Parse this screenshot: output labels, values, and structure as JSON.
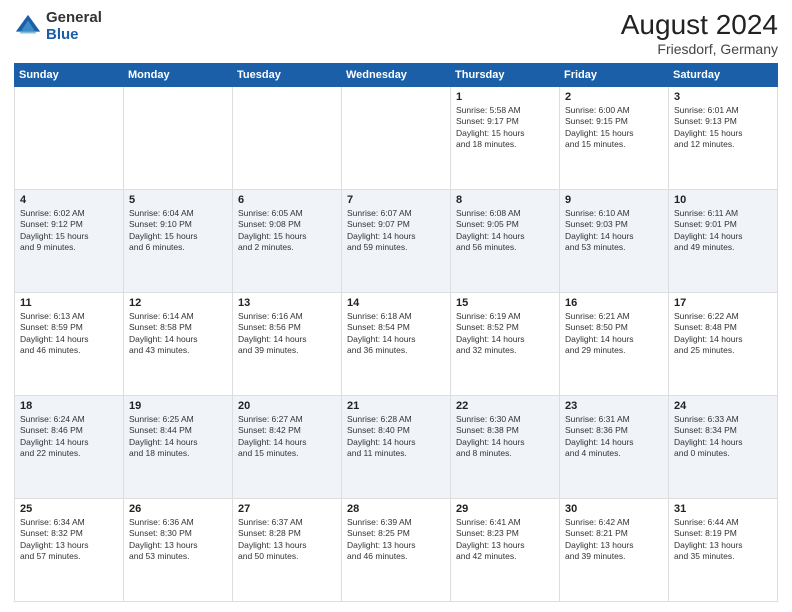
{
  "header": {
    "logo_general": "General",
    "logo_blue": "Blue",
    "title": "August 2024",
    "subtitle": "Friesdorf, Germany"
  },
  "days_of_week": [
    "Sunday",
    "Monday",
    "Tuesday",
    "Wednesday",
    "Thursday",
    "Friday",
    "Saturday"
  ],
  "weeks": [
    [
      {
        "day": "",
        "info": ""
      },
      {
        "day": "",
        "info": ""
      },
      {
        "day": "",
        "info": ""
      },
      {
        "day": "",
        "info": ""
      },
      {
        "day": "1",
        "info": "Sunrise: 5:58 AM\nSunset: 9:17 PM\nDaylight: 15 hours\nand 18 minutes."
      },
      {
        "day": "2",
        "info": "Sunrise: 6:00 AM\nSunset: 9:15 PM\nDaylight: 15 hours\nand 15 minutes."
      },
      {
        "day": "3",
        "info": "Sunrise: 6:01 AM\nSunset: 9:13 PM\nDaylight: 15 hours\nand 12 minutes."
      }
    ],
    [
      {
        "day": "4",
        "info": "Sunrise: 6:02 AM\nSunset: 9:12 PM\nDaylight: 15 hours\nand 9 minutes."
      },
      {
        "day": "5",
        "info": "Sunrise: 6:04 AM\nSunset: 9:10 PM\nDaylight: 15 hours\nand 6 minutes."
      },
      {
        "day": "6",
        "info": "Sunrise: 6:05 AM\nSunset: 9:08 PM\nDaylight: 15 hours\nand 2 minutes."
      },
      {
        "day": "7",
        "info": "Sunrise: 6:07 AM\nSunset: 9:07 PM\nDaylight: 14 hours\nand 59 minutes."
      },
      {
        "day": "8",
        "info": "Sunrise: 6:08 AM\nSunset: 9:05 PM\nDaylight: 14 hours\nand 56 minutes."
      },
      {
        "day": "9",
        "info": "Sunrise: 6:10 AM\nSunset: 9:03 PM\nDaylight: 14 hours\nand 53 minutes."
      },
      {
        "day": "10",
        "info": "Sunrise: 6:11 AM\nSunset: 9:01 PM\nDaylight: 14 hours\nand 49 minutes."
      }
    ],
    [
      {
        "day": "11",
        "info": "Sunrise: 6:13 AM\nSunset: 8:59 PM\nDaylight: 14 hours\nand 46 minutes."
      },
      {
        "day": "12",
        "info": "Sunrise: 6:14 AM\nSunset: 8:58 PM\nDaylight: 14 hours\nand 43 minutes."
      },
      {
        "day": "13",
        "info": "Sunrise: 6:16 AM\nSunset: 8:56 PM\nDaylight: 14 hours\nand 39 minutes."
      },
      {
        "day": "14",
        "info": "Sunrise: 6:18 AM\nSunset: 8:54 PM\nDaylight: 14 hours\nand 36 minutes."
      },
      {
        "day": "15",
        "info": "Sunrise: 6:19 AM\nSunset: 8:52 PM\nDaylight: 14 hours\nand 32 minutes."
      },
      {
        "day": "16",
        "info": "Sunrise: 6:21 AM\nSunset: 8:50 PM\nDaylight: 14 hours\nand 29 minutes."
      },
      {
        "day": "17",
        "info": "Sunrise: 6:22 AM\nSunset: 8:48 PM\nDaylight: 14 hours\nand 25 minutes."
      }
    ],
    [
      {
        "day": "18",
        "info": "Sunrise: 6:24 AM\nSunset: 8:46 PM\nDaylight: 14 hours\nand 22 minutes."
      },
      {
        "day": "19",
        "info": "Sunrise: 6:25 AM\nSunset: 8:44 PM\nDaylight: 14 hours\nand 18 minutes."
      },
      {
        "day": "20",
        "info": "Sunrise: 6:27 AM\nSunset: 8:42 PM\nDaylight: 14 hours\nand 15 minutes."
      },
      {
        "day": "21",
        "info": "Sunrise: 6:28 AM\nSunset: 8:40 PM\nDaylight: 14 hours\nand 11 minutes."
      },
      {
        "day": "22",
        "info": "Sunrise: 6:30 AM\nSunset: 8:38 PM\nDaylight: 14 hours\nand 8 minutes."
      },
      {
        "day": "23",
        "info": "Sunrise: 6:31 AM\nSunset: 8:36 PM\nDaylight: 14 hours\nand 4 minutes."
      },
      {
        "day": "24",
        "info": "Sunrise: 6:33 AM\nSunset: 8:34 PM\nDaylight: 14 hours\nand 0 minutes."
      }
    ],
    [
      {
        "day": "25",
        "info": "Sunrise: 6:34 AM\nSunset: 8:32 PM\nDaylight: 13 hours\nand 57 minutes."
      },
      {
        "day": "26",
        "info": "Sunrise: 6:36 AM\nSunset: 8:30 PM\nDaylight: 13 hours\nand 53 minutes."
      },
      {
        "day": "27",
        "info": "Sunrise: 6:37 AM\nSunset: 8:28 PM\nDaylight: 13 hours\nand 50 minutes."
      },
      {
        "day": "28",
        "info": "Sunrise: 6:39 AM\nSunset: 8:25 PM\nDaylight: 13 hours\nand 46 minutes."
      },
      {
        "day": "29",
        "info": "Sunrise: 6:41 AM\nSunset: 8:23 PM\nDaylight: 13 hours\nand 42 minutes."
      },
      {
        "day": "30",
        "info": "Sunrise: 6:42 AM\nSunset: 8:21 PM\nDaylight: 13 hours\nand 39 minutes."
      },
      {
        "day": "31",
        "info": "Sunrise: 6:44 AM\nSunset: 8:19 PM\nDaylight: 13 hours\nand 35 minutes."
      }
    ]
  ]
}
